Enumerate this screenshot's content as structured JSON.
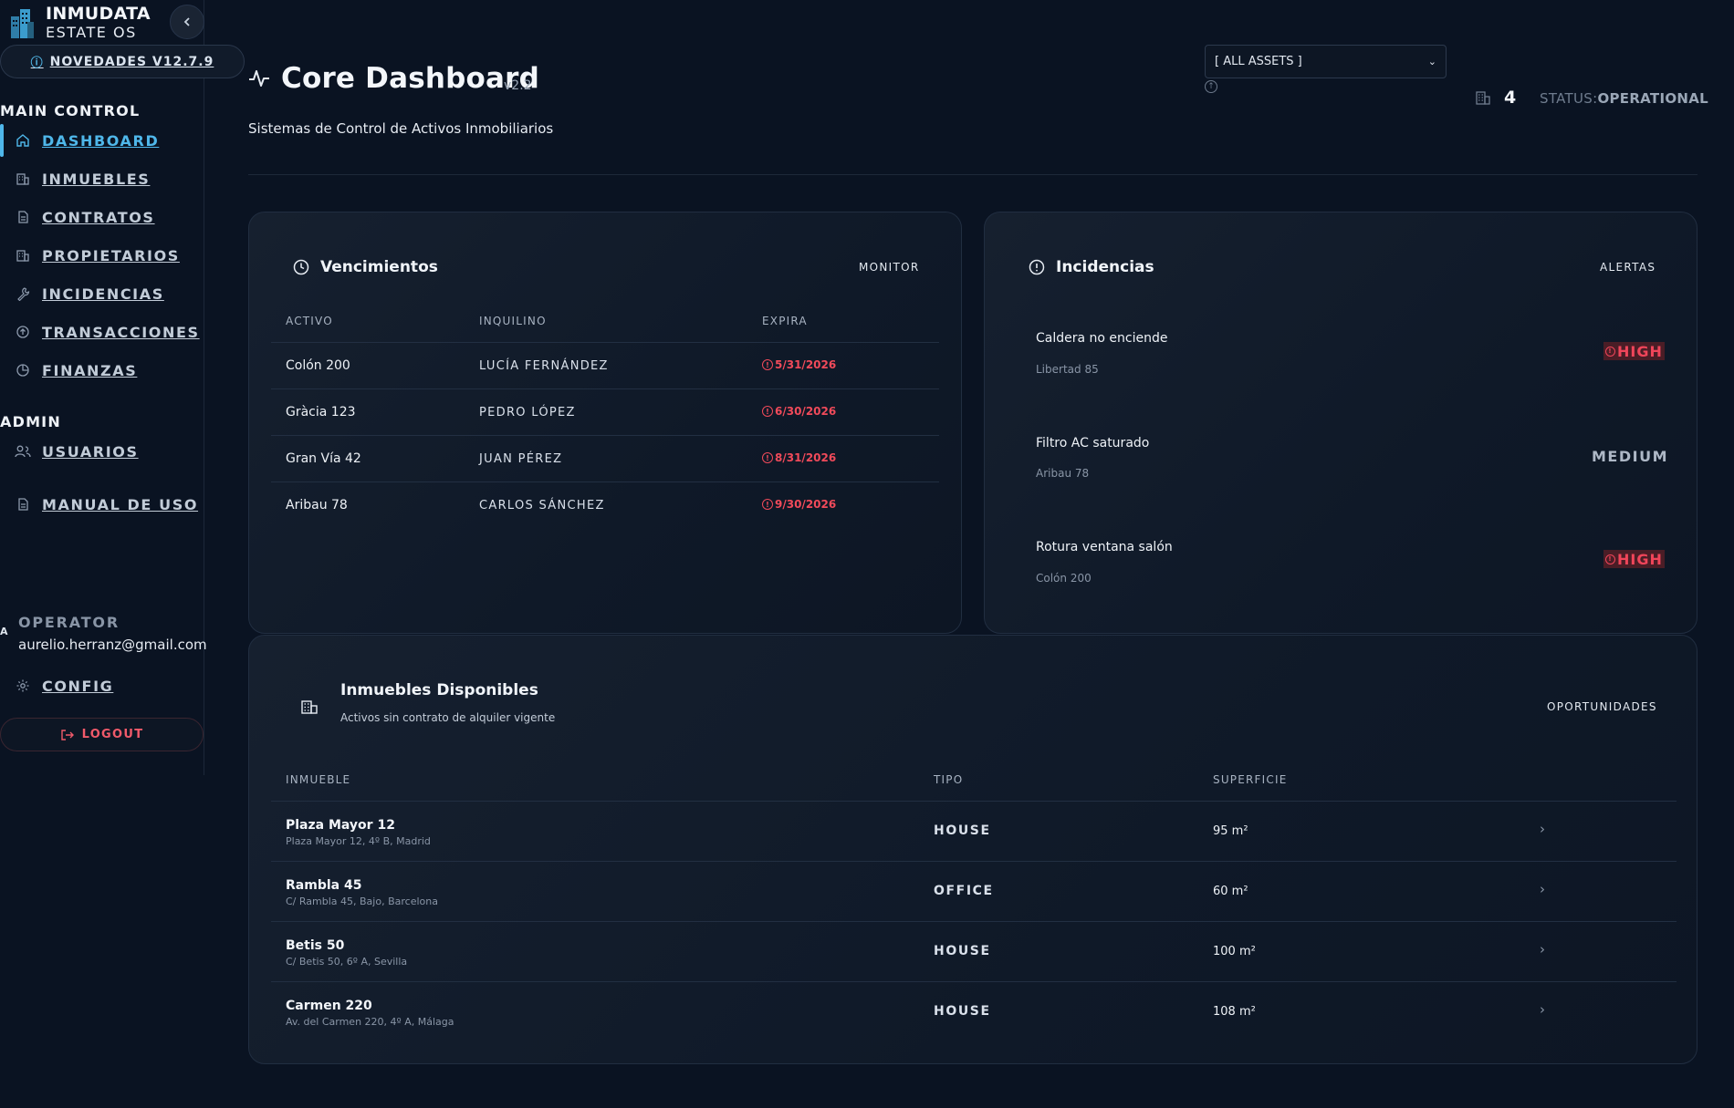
{
  "brand": {
    "title": "INMUDATA",
    "subtitle": "ESTATE OS"
  },
  "news": {
    "label": "NOVEDADES V12.7.9"
  },
  "sidebar": {
    "main_label": "MAIN CONTROL",
    "main_items": [
      {
        "label": "DASHBOARD",
        "icon": "home-icon",
        "active": true
      },
      {
        "label": "INMUEBLES",
        "icon": "building-icon"
      },
      {
        "label": "CONTRATOS",
        "icon": "document-icon"
      },
      {
        "label": "PROPIETARIOS",
        "icon": "building-icon"
      },
      {
        "label": "INCIDENCIAS",
        "icon": "wrench-icon"
      },
      {
        "label": "TRANSACCIONES",
        "icon": "arrow-up-circle-icon"
      },
      {
        "label": "FINANZAS",
        "icon": "pie-chart-icon"
      }
    ],
    "admin_label": "ADMIN",
    "admin_items": [
      {
        "label": "USUARIOS",
        "icon": "users-icon"
      },
      {
        "label": "MANUAL DE USO",
        "icon": "document-icon"
      }
    ],
    "operator": {
      "avatar": "A",
      "label": "OPERATOR",
      "email": "aurelio.herranz@gmail.com"
    },
    "config_label": "CONFIG",
    "logout_label": "LOGOUT"
  },
  "header": {
    "title": "Core Dashboard",
    "version": "v2.2",
    "subtitle": "Sistemas de Control de Activos Inmobiliarios",
    "asset_select": "[ ALL ASSETS ]",
    "asset_count": "4",
    "status_label": "STATUS:",
    "status_value": "OPERATIONAL"
  },
  "vencimientos": {
    "title": "Vencimientos",
    "tag": "MONITOR",
    "columns": [
      "ACTIVO",
      "INQUILINO",
      "EXPIRA"
    ],
    "rows": [
      {
        "asset": "Colón 200",
        "tenant": "LUCÍA FERNÁNDEZ",
        "expires": "5/31/2026"
      },
      {
        "asset": "Gràcia 123",
        "tenant": "PEDRO LÓPEZ",
        "expires": "6/30/2026"
      },
      {
        "asset": "Gran Vía 42",
        "tenant": "JUAN PÉREZ",
        "expires": "8/31/2026"
      },
      {
        "asset": "Aribau 78",
        "tenant": "CARLOS SÁNCHEZ",
        "expires": "9/30/2026"
      }
    ]
  },
  "incidencias": {
    "title": "Incidencias",
    "tag": "ALERTAS",
    "items": [
      {
        "title": "Caldera no enciende",
        "location": "Libertad 85",
        "priority": "HIGH"
      },
      {
        "title": "Filtro AC saturado",
        "location": "Aribau 78",
        "priority": "MEDIUM"
      },
      {
        "title": "Rotura ventana salón",
        "location": "Colón 200",
        "priority": "HIGH"
      }
    ]
  },
  "disponibles": {
    "title": "Inmuebles Disponibles",
    "subtitle": "Activos sin contrato de alquiler vigente",
    "tag": "OPORTUNIDADES",
    "columns": [
      "INMUEBLE",
      "TIPO",
      "SUPERFICIE"
    ],
    "rows": [
      {
        "name": "Plaza Mayor 12",
        "address": "Plaza Mayor 12, 4º B, Madrid",
        "type": "HOUSE",
        "area": "95 m²"
      },
      {
        "name": "Rambla 45",
        "address": "C/ Rambla 45, Bajo, Barcelona",
        "type": "OFFICE",
        "area": "60 m²"
      },
      {
        "name": "Betis 50",
        "address": "C/ Betis 50, 6º A, Sevilla",
        "type": "HOUSE",
        "area": "100 m²"
      },
      {
        "name": "Carmen 220",
        "address": "Av. del Carmen 220, 4º A, Málaga",
        "type": "HOUSE",
        "area": "108 m²"
      }
    ]
  },
  "colors": {
    "accent": "#4fb7ea",
    "danger": "#f04a5a",
    "background": "#0a1322"
  }
}
